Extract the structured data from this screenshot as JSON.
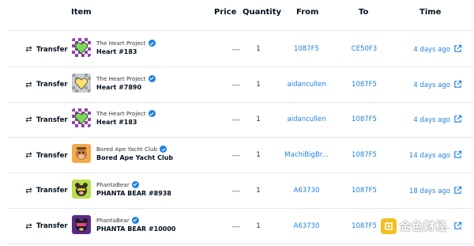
{
  "columns": {
    "item": "Item",
    "price": "Price",
    "quantity": "Quantity",
    "from": "From",
    "to": "To",
    "time": "Time"
  },
  "rows": [
    {
      "event": "Transfer",
      "event_icon": "transfer-arrows-icon",
      "collection": "The Heart Project",
      "name": "Heart #183",
      "thumb": "heart-checker",
      "price": "---",
      "quantity": "1",
      "from": "1087F5",
      "to": "CE50F3",
      "time": "4 days ago"
    },
    {
      "event": "Transfer",
      "event_icon": "transfer-arrows-icon",
      "collection": "The Heart Project",
      "name": "Heart #7890",
      "thumb": "heart-gray",
      "price": "---",
      "quantity": "1",
      "from": "aidancullen",
      "to": "1087F5",
      "time": "4 days ago"
    },
    {
      "event": "Transfer",
      "event_icon": "transfer-arrows-icon",
      "collection": "The Heart Project",
      "name": "Heart #183",
      "thumb": "heart-checker",
      "price": "---",
      "quantity": "1",
      "from": "aidancullen",
      "to": "1087F5",
      "time": "4 days ago"
    },
    {
      "event": "Transfer",
      "event_icon": "transfer-arrows-icon",
      "collection": "Bored Ape Yacht Club",
      "name": "Bored Ape Yacht Club",
      "thumb": "ape-orange",
      "price": "---",
      "quantity": "1",
      "from": "MachiBigBr...",
      "to": "1087F5",
      "time": "14 days ago"
    },
    {
      "event": "Transfer",
      "event_icon": "transfer-arrows-icon",
      "collection": "PhantaBear",
      "name": "PHANTA BEAR #8938",
      "thumb": "bear-green",
      "price": "---",
      "quantity": "1",
      "from": "A63730",
      "to": "1087F5",
      "time": "18 days ago"
    },
    {
      "event": "Transfer",
      "event_icon": "transfer-arrows-icon",
      "collection": "PhantaBear",
      "name": "PHANTA BEAR #10000",
      "thumb": "bear-purple",
      "price": "---",
      "quantity": "1",
      "from": "A63730",
      "to": "1087F5",
      "time": "..."
    }
  ],
  "watermark": {
    "text": "金色财经"
  },
  "colors": {
    "link": "#2081e2",
    "border": "#e5e8eb",
    "verified": "#2081e2"
  }
}
